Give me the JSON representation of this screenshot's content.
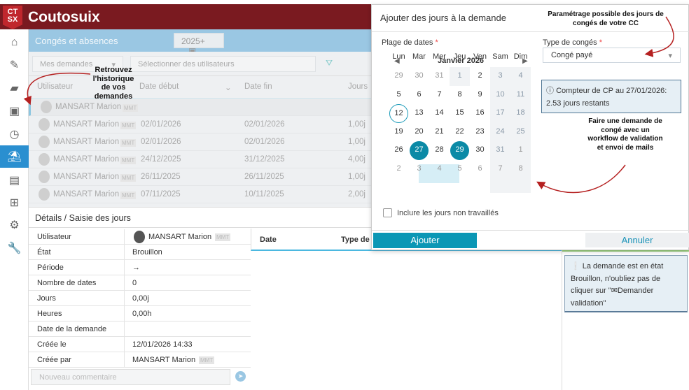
{
  "app": {
    "logo": "CTSX",
    "name": "Coutosuix"
  },
  "sidebar": {
    "items": [
      "home-icon",
      "report-icon",
      "folder-icon",
      "calendar-icon",
      "clock-icon",
      "beach-icon",
      "money-icon",
      "grid-icon",
      "settings-icon",
      "wrench-icon"
    ],
    "active": 5
  },
  "page": {
    "title": "Congés et absences",
    "year": "2025+"
  },
  "filters": {
    "requests": "Mes demandes",
    "users_placeholder": "Sélectionner des utilisateurs"
  },
  "table": {
    "headers": [
      "Utilisateur",
      "Date début",
      "Date fin",
      "Jours"
    ],
    "rows": [
      {
        "user": "MANSART Marion",
        "tag": "MMT",
        "start": "",
        "end": "",
        "days": ""
      },
      {
        "user": "MANSART Marion",
        "tag": "MMT",
        "start": "02/01/2026",
        "end": "02/01/2026",
        "days": "1,00j"
      },
      {
        "user": "MANSART Marion",
        "tag": "MMT",
        "start": "02/01/2026",
        "end": "02/01/2026",
        "days": "1,00j"
      },
      {
        "user": "MANSART Marion",
        "tag": "MMT",
        "start": "24/12/2025",
        "end": "31/12/2025",
        "days": "4,00j"
      },
      {
        "user": "MANSART Marion",
        "tag": "MMT",
        "start": "26/11/2025",
        "end": "26/11/2025",
        "days": "1,00j"
      },
      {
        "user": "MANSART Marion",
        "tag": "MMT",
        "start": "07/11/2025",
        "end": "10/11/2025",
        "days": "2,00j"
      }
    ]
  },
  "details": {
    "title": "Détails / Saisie des jours",
    "rows": [
      {
        "k": "Utilisateur",
        "v": "MANSART Marion",
        "tag": "MMT"
      },
      {
        "k": "État",
        "v": "Brouillon"
      },
      {
        "k": "Période",
        "v": "→"
      },
      {
        "k": "Nombre de dates",
        "v": "0"
      },
      {
        "k": "Jours",
        "v": "0,00j"
      },
      {
        "k": "Heures",
        "v": "0,00h"
      },
      {
        "k": "Date de la demande",
        "v": ""
      },
      {
        "k": "Créée le",
        "v": "12/01/2026 14:33"
      },
      {
        "k": "Créée par",
        "v": "MANSART Marion",
        "tag": "MMT"
      }
    ],
    "comment_placeholder": "Nouveau commentaire"
  },
  "days_table": {
    "headers": [
      "Date",
      "Type de"
    ]
  },
  "warning": {
    "text": "La demande est en état Brouillon, n'oubliez pas de cliquer sur \"",
    "action": "Demander validation\""
  },
  "modal": {
    "title": "Ajouter des jours à la demande",
    "date_range_label": "Plage de dates",
    "required": "*",
    "month": "Janvier 2026",
    "weekdays": [
      "Lun",
      "Mar",
      "Mer",
      "Jeu",
      "Ven",
      "Sam",
      "Dim"
    ],
    "weeks": [
      [
        "29",
        "30",
        "31",
        "1",
        "2",
        "3",
        "4"
      ],
      [
        "5",
        "6",
        "7",
        "8",
        "9",
        "10",
        "11"
      ],
      [
        "12",
        "13",
        "14",
        "15",
        "16",
        "17",
        "18"
      ],
      [
        "19",
        "20",
        "21",
        "22",
        "23",
        "24",
        "25"
      ],
      [
        "26",
        "27",
        "28",
        "29",
        "30",
        "31",
        "1"
      ],
      [
        "2",
        "3",
        "4",
        "5",
        "6",
        "7",
        "8"
      ]
    ],
    "type_label": "Type de congés",
    "type_value": "Congé payé",
    "counter_line1": "Compteur de CP au 27/01/2026:",
    "counter_line2": "2.53 jours restants",
    "include_label": "Inclure les jours non travaillés",
    "add": "Ajouter",
    "cancel": "Annuler"
  },
  "annotations": {
    "history": "Retrouvez l'historique de vos demandes",
    "settings": "Paramétrage possible des jours de congés de votre CC",
    "workflow": "Faire une demande de congé avec un workflow de validation et envoi de mails"
  },
  "colors": {
    "header": "#7a1a20",
    "accent": "#0b97b5",
    "annotation_arrow": "#b52020"
  }
}
